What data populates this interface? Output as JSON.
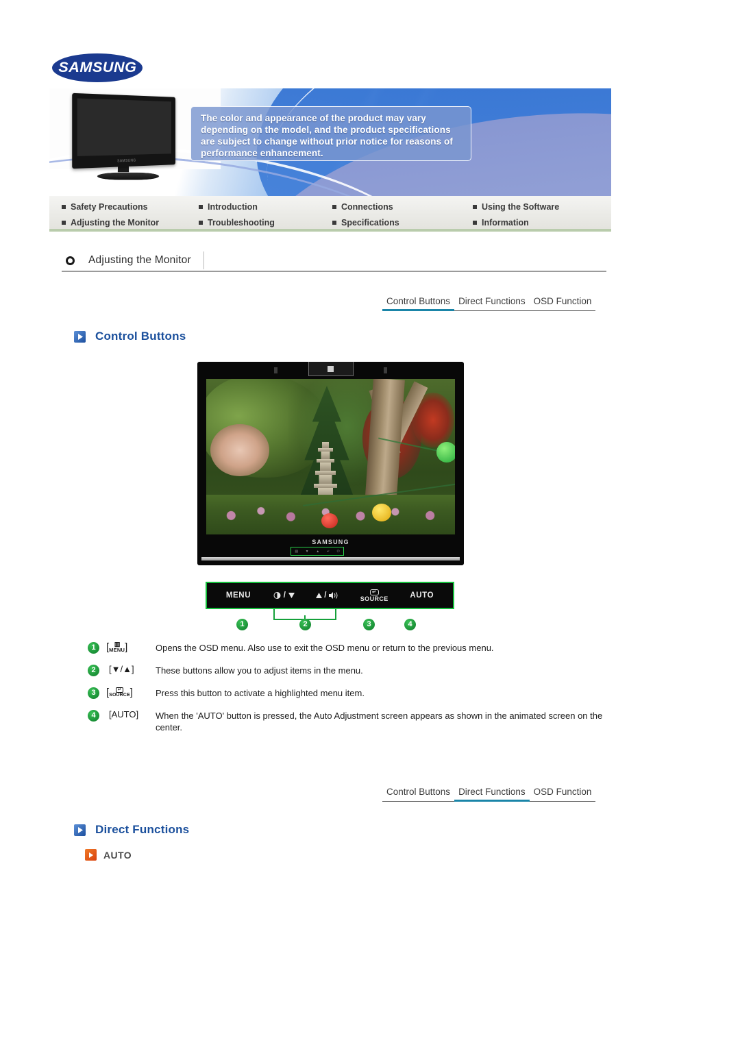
{
  "brand": {
    "logo_text": "SAMSUNG",
    "logo_color": "#1b3a8f"
  },
  "hero": {
    "note_text": "The color and appearance of the product may vary depending on the model, and the product specifications are subject to change without prior notice for reasons of performance enhancement.",
    "monitor_brand": "SAMSUNG"
  },
  "nav": {
    "items": [
      {
        "label": "Safety Precautions"
      },
      {
        "label": "Introduction"
      },
      {
        "label": "Connections"
      },
      {
        "label": "Using the Software"
      },
      {
        "label": "Adjusting the Monitor"
      },
      {
        "label": "Troubleshooting"
      },
      {
        "label": "Specifications"
      },
      {
        "label": "Information"
      }
    ]
  },
  "page": {
    "title": "Adjusting the Monitor"
  },
  "tabs_top": {
    "items": [
      {
        "label": "Control Buttons",
        "active": true
      },
      {
        "label": "Direct Functions",
        "active": false
      },
      {
        "label": "OSD Function",
        "active": false
      }
    ],
    "accent": "#1a85a8"
  },
  "tabs_bottom": {
    "items": [
      {
        "label": "Control Buttons",
        "active": false
      },
      {
        "label": "Direct Functions",
        "active": true
      },
      {
        "label": "OSD Function",
        "active": false
      }
    ],
    "accent": "#1a85a8"
  },
  "section_control_buttons": {
    "heading": "Control Buttons",
    "heading_color": "#1a4f9c",
    "monitor_brand": "SAMSUNG",
    "control_bar": {
      "menu_label": "MENU",
      "down_label": "/",
      "up_label": "/",
      "source_icon": "↵",
      "source_label": "SOURCE",
      "auto_label": "AUTO"
    },
    "callouts": [
      {
        "number": "1",
        "key": "MENU",
        "key_display": "[MENU]",
        "text": "Opens the OSD menu. Also use to exit the OSD menu or return to the previous menu."
      },
      {
        "number": "2",
        "key": "▼/▲",
        "key_display": "[▼/▲]",
        "text": "These buttons allow you to adjust items in the menu."
      },
      {
        "number": "3",
        "key": "SOURCE",
        "key_display": "[SOURCE]",
        "text": "Press this button to activate a highlighted menu item."
      },
      {
        "number": "4",
        "key": "AUTO",
        "key_display": "[AUTO]",
        "text": "When the 'AUTO' button is pressed, the Auto Adjustment screen appears as shown in the animated screen on the center."
      }
    ],
    "callout_color": "#0e7c2a"
  },
  "section_direct_functions": {
    "heading": "Direct Functions",
    "heading_color": "#1a4f9c",
    "items": [
      {
        "label": "AUTO",
        "icon_color": "#d8400c"
      }
    ]
  }
}
